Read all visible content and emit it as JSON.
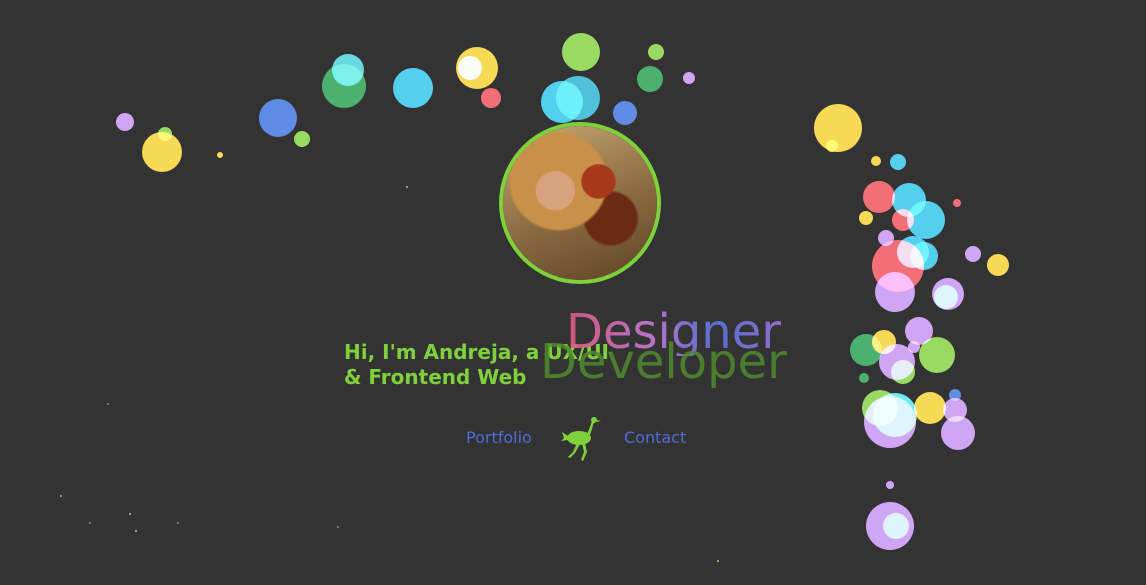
{
  "hero": {
    "intro_line1": "Hi, I'm Andreja, a UX/UI",
    "intro_line2": "& Frontend Web",
    "role_words": [
      "Designer",
      "Developer"
    ]
  },
  "nav": {
    "portfolio_label": "Portfolio",
    "contact_label": "Contact",
    "logo_icon": "ostrich-logo-icon"
  },
  "avatar_icon": "profile-photo",
  "colors": {
    "background": "#333333",
    "accent_green": "#7fd13b",
    "link_blue": "#4d6ed6",
    "bubble_palette": [
      "#f4d12a",
      "#29c3e8",
      "#1f9e4b",
      "#7fd13b",
      "#3a6fe0",
      "#f04b55",
      "#c48ef0",
      "#4be4f0"
    ]
  }
}
